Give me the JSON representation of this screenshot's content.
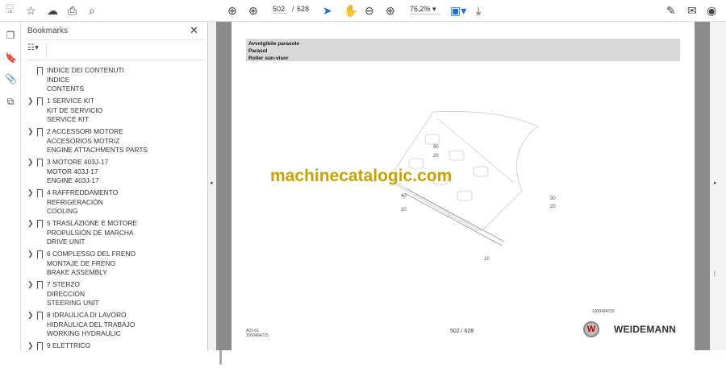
{
  "toolbar": {
    "page_current": "502",
    "page_sep": "/",
    "page_total": "628",
    "zoom": "76,2%"
  },
  "bookmarks": {
    "title": "Bookmarks",
    "items": [
      {
        "lines": [
          "INDICE DEI CONTENUTI",
          "ÍNDICE",
          "CONTENTS"
        ],
        "expandable": false
      },
      {
        "lines": [
          "1 SERVICE KIT",
          "KIT DE SERVICIO",
          "SERVICE KIT"
        ],
        "expandable": true
      },
      {
        "lines": [
          "2 ACCESSORI MOTORE",
          "ACCESORIOS MOTRIZ",
          "ENGINE ATTACHMENTS PARTS"
        ],
        "expandable": true
      },
      {
        "lines": [
          "3 MOTORE 403J-17",
          "MOTOR 403J-17",
          "ENGINE 403J-17"
        ],
        "expandable": true
      },
      {
        "lines": [
          "4 RAFFREDDAMENTO",
          "REFRIGERACIÓN",
          "COOLING"
        ],
        "expandable": true
      },
      {
        "lines": [
          "5 TRASLAZIONE E MOTORE",
          "PROPULSIÓN DE MARCHA",
          "DRIVE UNIT"
        ],
        "expandable": true
      },
      {
        "lines": [
          "6 COMPLESSO DEL FRENO",
          "MONTAJE DE FRENO",
          "BRAKE ASSEMBLY"
        ],
        "expandable": true
      },
      {
        "lines": [
          "7 STERZO",
          "DIRECCIÓN",
          "STEERING UNIT"
        ],
        "expandable": true
      },
      {
        "lines": [
          "8 IDRAULICA DI LAVORO",
          "HIDRÁULICA DEL TRABAJO",
          "WORKING HYDRAULIC"
        ],
        "expandable": true
      },
      {
        "lines": [
          "9 ELETTRICO",
          "",
          ""
        ],
        "expandable": true
      }
    ]
  },
  "page": {
    "header": [
      "Avvolgibile parasole",
      "Parasol",
      "Roller sun-visor"
    ],
    "watermark": "machinecatalogic.com",
    "callouts": [
      "30",
      "20",
      "40",
      "10",
      "30",
      "20",
      "10"
    ],
    "drawing_no": "1000494715",
    "footer_code": "A02-01",
    "footer_no": "1000494715",
    "page_label": "502 / 628",
    "brand": "WEIDEMANN"
  }
}
